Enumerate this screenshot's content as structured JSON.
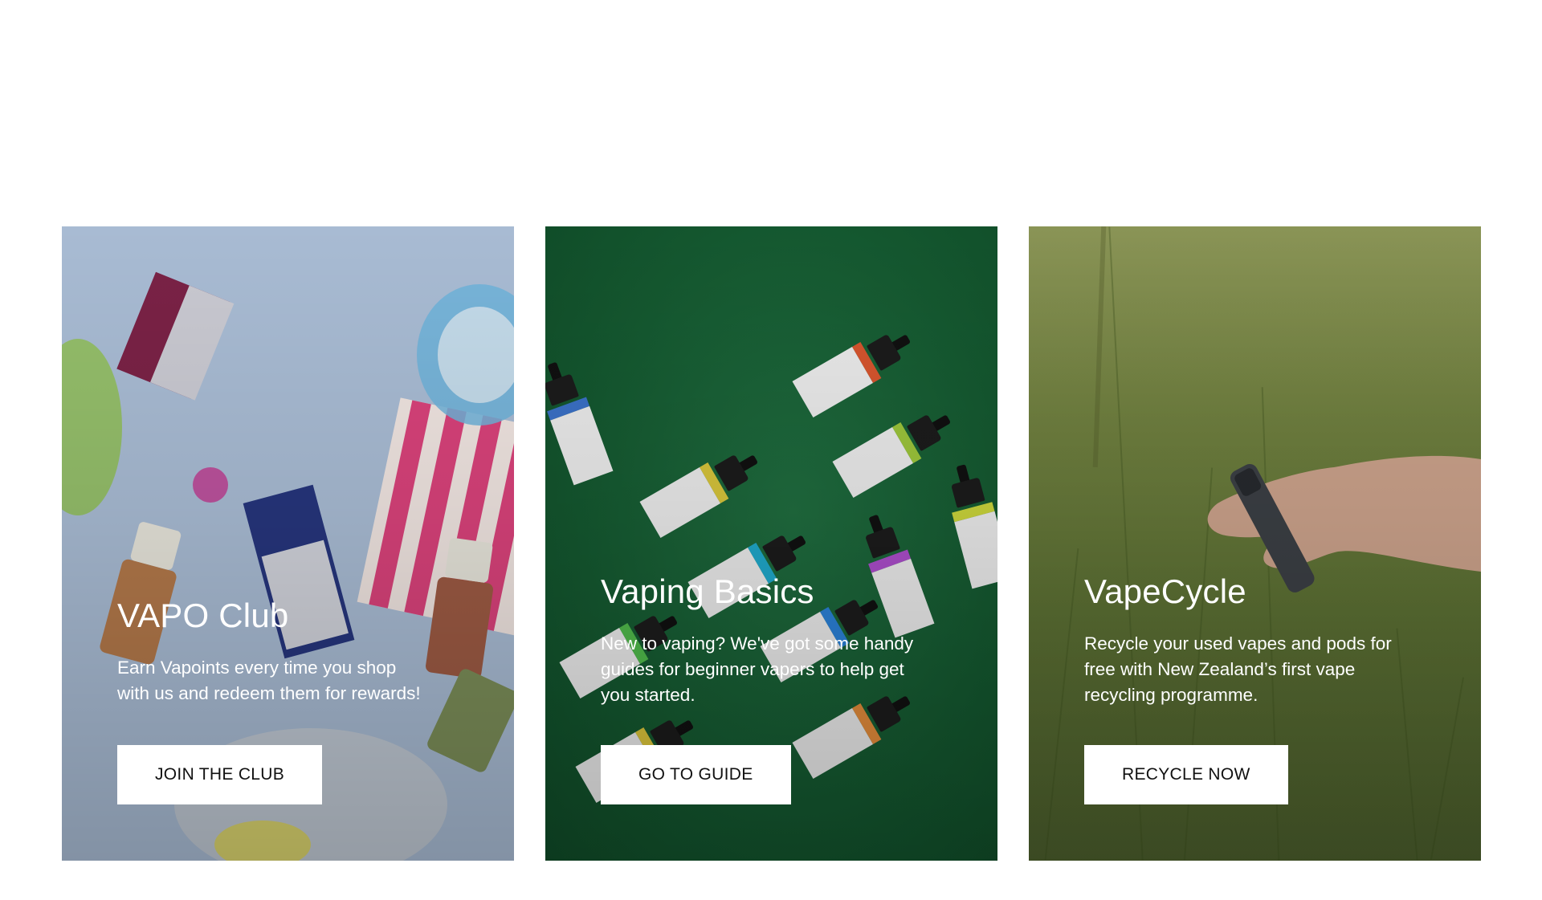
{
  "cards": [
    {
      "title": "VAPO Club",
      "description": "Earn Vapoints every time you shop with us and redeem them for rewards!",
      "button_label": "JOIN THE CLUB"
    },
    {
      "title": "Vaping Basics",
      "description": "New to vaping? We've got some handy guides for beginner vapers to help get you started.",
      "button_label": "GO TO GUIDE"
    },
    {
      "title": "VapeCycle",
      "description": "Recycle your used vapes and pods for free with New Zealand’s first vape recycling programme.",
      "button_label": "RECYCLE NOW"
    }
  ],
  "colors": {
    "card1_bg": "#a8bbd3",
    "card2_bg": "#1a6236",
    "card3_bg": "#5e7034",
    "button_bg": "#ffffff",
    "button_text": "#111111",
    "card_text": "#ffffff"
  }
}
